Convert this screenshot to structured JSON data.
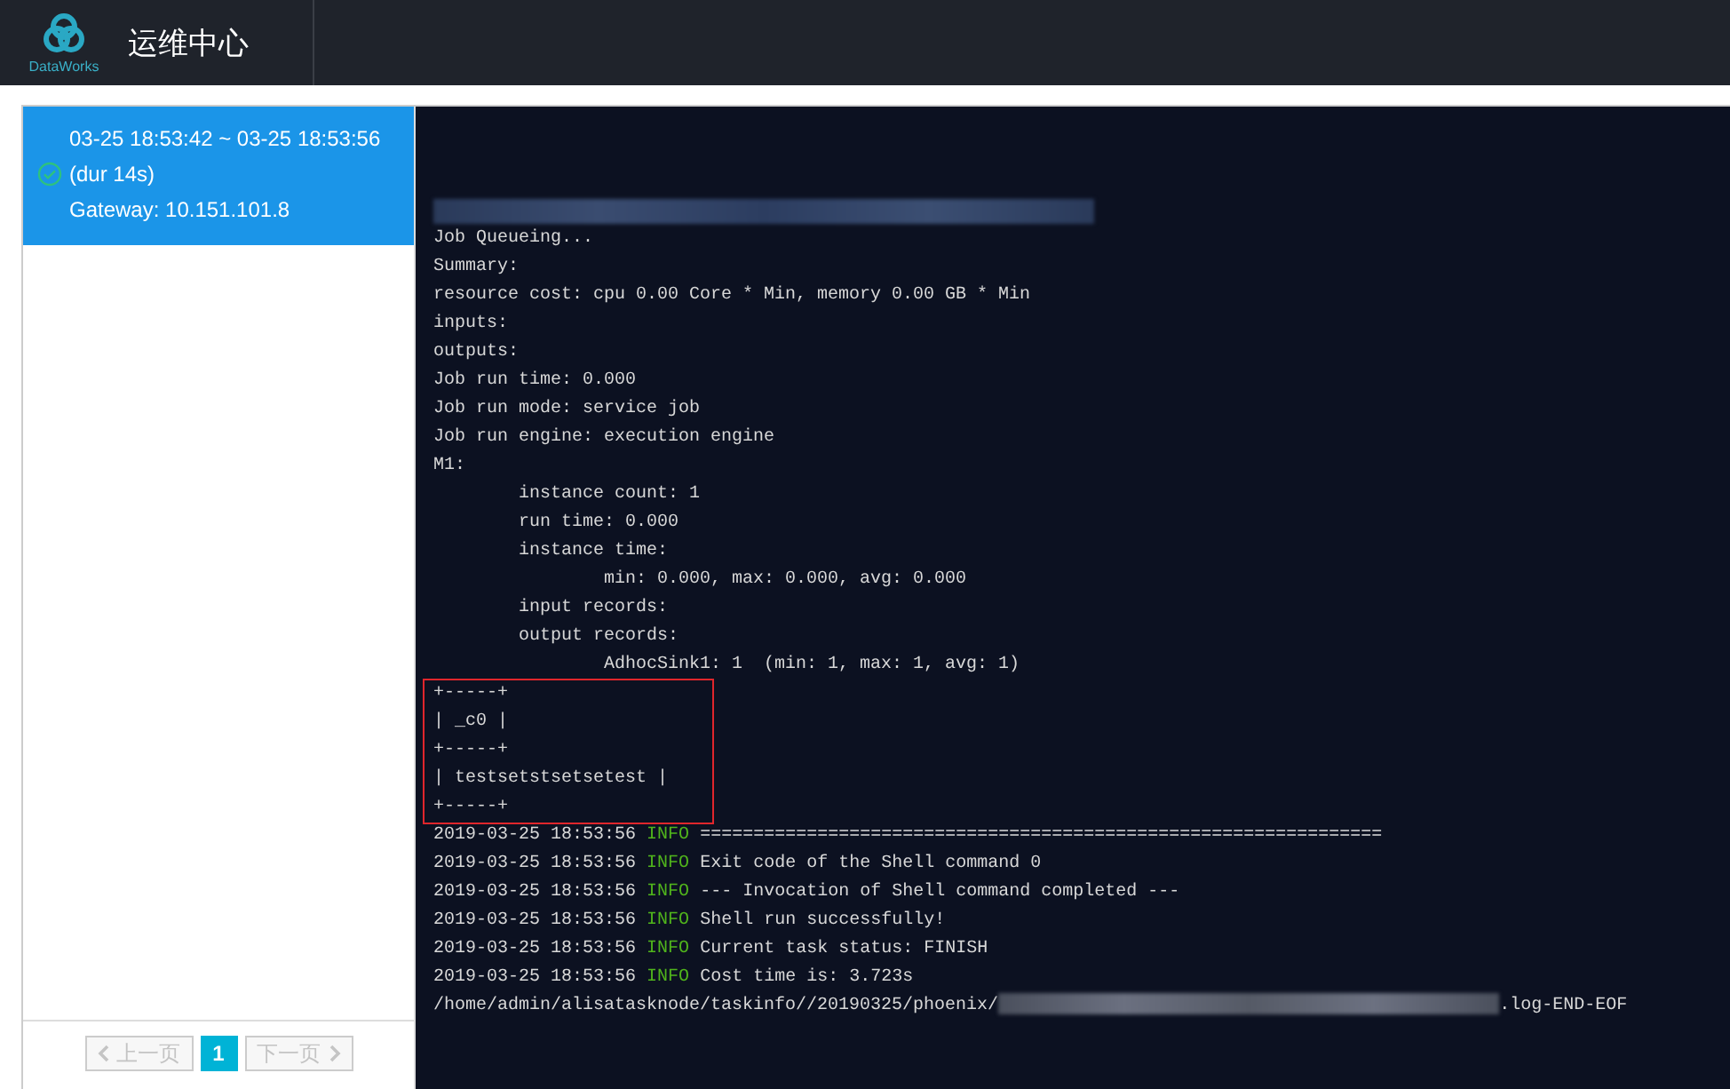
{
  "header": {
    "product": "DataWorks",
    "title": "运维中心"
  },
  "runs": [
    {
      "range": "03-25 18:53:42 ~ 03-25 18:53:56",
      "duration": "(dur 14s)",
      "gateway": "Gateway: 10.151.101.8",
      "selected": true,
      "kind": "success"
    }
  ],
  "pagination": {
    "prev": {
      "label": "上一页",
      "disabled": true
    },
    "pages": [
      {
        "label": "1",
        "selected": true
      }
    ],
    "next": {
      "label": "下一页",
      "disabled": true
    }
  },
  "log": {
    "sections": [
      {
        "highlighted": false,
        "lines": [
          {
            "kind": "redacted"
          },
          {
            "kind": "text",
            "text": "Job Queueing..."
          },
          {
            "kind": "text",
            "text": "Summary:"
          },
          {
            "kind": "text",
            "text": "resource cost: cpu 0.00 Core * Min, memory 0.00 GB * Min"
          },
          {
            "kind": "text",
            "text": "inputs:"
          },
          {
            "kind": "text",
            "text": "outputs:"
          },
          {
            "kind": "text",
            "text": "Job run time: 0.000"
          },
          {
            "kind": "text",
            "text": "Job run mode: service job"
          },
          {
            "kind": "text",
            "text": "Job run engine: execution engine"
          },
          {
            "kind": "text",
            "text": "M1:"
          },
          {
            "kind": "text",
            "text": "\tinstance count: 1"
          },
          {
            "kind": "text",
            "text": "\trun time: 0.000"
          },
          {
            "kind": "text",
            "text": "\tinstance time:"
          },
          {
            "kind": "text",
            "text": "\t\tmin: 0.000, max: 0.000, avg: 0.000"
          },
          {
            "kind": "text",
            "text": "\tinput records:"
          },
          {
            "kind": "text",
            "text": "\toutput records:"
          },
          {
            "kind": "text",
            "text": "\t\tAdhocSink1: 1  (min: 1, max: 1, avg: 1)"
          }
        ]
      },
      {
        "highlighted": true,
        "lines": [
          {
            "kind": "text",
            "text": "+-----+"
          },
          {
            "kind": "text",
            "text": "| _c0 |"
          },
          {
            "kind": "text",
            "text": "+-----+"
          },
          {
            "kind": "text",
            "text": "| testsetstsetsetest |"
          },
          {
            "kind": "text",
            "text": "+-----+"
          }
        ]
      },
      {
        "highlighted": false,
        "lines": [
          {
            "kind": "info",
            "time": "2019-03-25 18:53:56",
            "level": "INFO",
            "message": "================================================================"
          },
          {
            "kind": "info",
            "time": "2019-03-25 18:53:56",
            "level": "INFO",
            "message": "Exit code of the Shell command 0"
          },
          {
            "kind": "info",
            "time": "2019-03-25 18:53:56",
            "level": "INFO",
            "message": "--- Invocation of Shell command completed ---"
          },
          {
            "kind": "info",
            "time": "2019-03-25 18:53:56",
            "level": "INFO",
            "message": "Shell run successfully!"
          },
          {
            "kind": "info",
            "time": "2019-03-25 18:53:56",
            "level": "INFO",
            "message": "Current task status: FINISH"
          },
          {
            "kind": "info",
            "time": "2019-03-25 18:53:56",
            "level": "INFO",
            "message": "Cost time is: 3.723s"
          },
          {
            "kind": "path",
            "prefix": "/home/admin/alisatasknode/taskinfo//20190325/phoenix/",
            "suffix": ".log-END-EOF"
          }
        ]
      }
    ]
  }
}
